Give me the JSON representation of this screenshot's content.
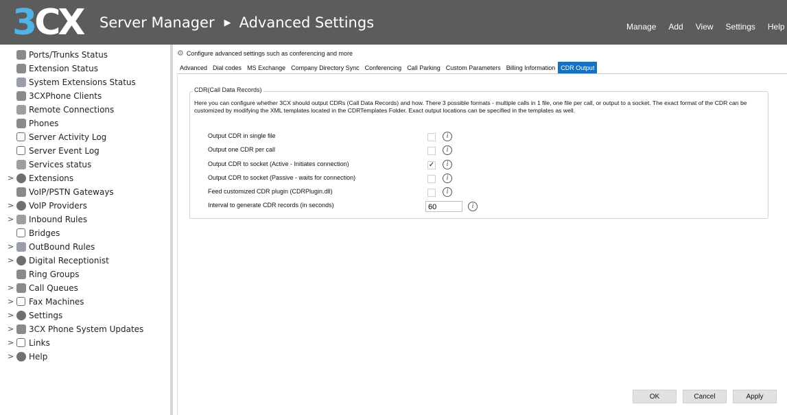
{
  "header": {
    "logo": "3CX",
    "app_title": "Server Manager",
    "page_title": "Advanced Settings",
    "menu": [
      "Manage",
      "Add",
      "View",
      "Settings",
      "Help"
    ]
  },
  "sidebar": {
    "items": [
      {
        "label": "Ports/Trunks Status",
        "icon": "ports-trunks-icon",
        "expandable": false
      },
      {
        "label": "Extension Status",
        "icon": "extension-status-icon",
        "expandable": false
      },
      {
        "label": "System Extensions Status",
        "icon": "system-extensions-icon",
        "expandable": false
      },
      {
        "label": "3CXPhone Clients",
        "icon": "phone-clients-icon",
        "expandable": false
      },
      {
        "label": "Remote Connections",
        "icon": "remote-connections-icon",
        "expandable": false
      },
      {
        "label": "Phones",
        "icon": "phone-icon",
        "expandable": false
      },
      {
        "label": "Server Activity Log",
        "icon": "activity-log-icon",
        "expandable": false
      },
      {
        "label": "Server Event Log",
        "icon": "event-log-icon",
        "expandable": false
      },
      {
        "label": "Services status",
        "icon": "services-icon",
        "expandable": false
      },
      {
        "label": "Extensions",
        "icon": "user-icon",
        "expandable": true
      },
      {
        "label": "VoIP/PSTN Gateways",
        "icon": "gateway-icon",
        "expandable": false
      },
      {
        "label": "VoIP Providers",
        "icon": "globe-icon",
        "expandable": true
      },
      {
        "label": "Inbound Rules",
        "icon": "arrow-down-icon",
        "expandable": true
      },
      {
        "label": "Bridges",
        "icon": "bridge-icon",
        "expandable": false
      },
      {
        "label": "OutBound Rules",
        "icon": "arrow-up-icon",
        "expandable": true
      },
      {
        "label": "Digital Receptionist",
        "icon": "receptionist-icon",
        "expandable": true
      },
      {
        "label": "Ring Groups",
        "icon": "ring-groups-icon",
        "expandable": false
      },
      {
        "label": "Call Queues",
        "icon": "call-queues-icon",
        "expandable": true
      },
      {
        "label": "Fax Machines",
        "icon": "fax-icon",
        "expandable": true
      },
      {
        "label": "Settings",
        "icon": "gear-icon",
        "expandable": true
      },
      {
        "label": "3CX Phone System Updates",
        "icon": "updates-icon",
        "expandable": true
      },
      {
        "label": "Links",
        "icon": "link-icon",
        "expandable": true
      },
      {
        "label": "Help",
        "icon": "help-icon",
        "expandable": true
      }
    ]
  },
  "main": {
    "description": "Configure advanced settings such as conferencing and more",
    "tabs": [
      "Advanced",
      "Dial codes",
      "MS Exchange",
      "Company Directory Sync",
      "Conferencing",
      "Call Parking",
      "Custom Parameters",
      "Billing Information",
      "CDR Output"
    ],
    "active_tab": "CDR Output",
    "cdr": {
      "legend": "CDR(Call Data Records)",
      "description": "Here you can configure whether 3CX should output CDRs (Call Data Records) and how. There 3 possible formats - multiple calls in 1 file, one file per call, or output to a socket. The exact format of the CDR can be customized by modifying the XML templates located in the CDRTemplates Folder. Exact output locations can be specified in the templates as well.",
      "options": [
        {
          "label": "Output CDR in single file",
          "checked": false
        },
        {
          "label": "Output one CDR per call",
          "checked": false
        },
        {
          "label": "Output CDR to socket (Active - Initiates connection)",
          "checked": true
        },
        {
          "label": "Output CDR to socket (Passive - waits for connection)",
          "checked": false
        },
        {
          "label": "Feed customized CDR plugin (CDRPlugin.dll)",
          "checked": false
        }
      ],
      "interval_label": "Interval to generate CDR records (in seconds)",
      "interval_value": "60"
    },
    "buttons": {
      "ok": "OK",
      "cancel": "Cancel",
      "apply": "Apply"
    }
  },
  "colors": {
    "header_bg": "#5c5c5c",
    "logo_accent": "#4fb3e8",
    "tab_active": "#1572c1"
  }
}
